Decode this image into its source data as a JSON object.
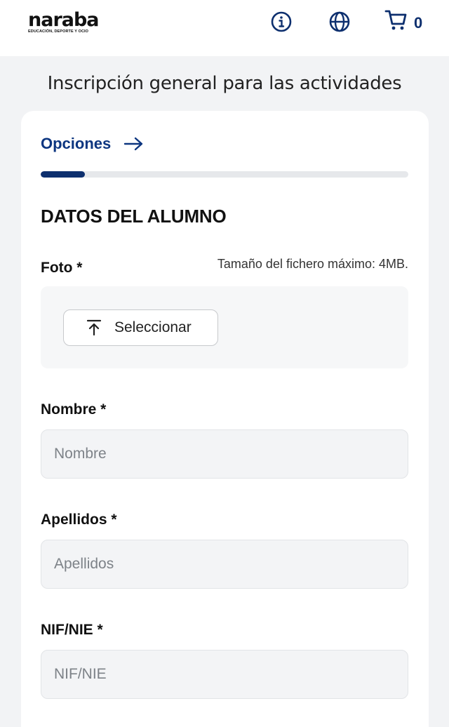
{
  "header": {
    "logo": {
      "word": "naraba",
      "tagline": "EDUCACIÓN, DEPORTE Y OCIO"
    },
    "icons": {
      "info": "info-icon",
      "language": "globe-icon",
      "cart": "cart-icon"
    },
    "cart_count": "0"
  },
  "page": {
    "title": "Inscripción general para las actividades"
  },
  "form": {
    "step_link": "Opciones",
    "progress_percent": 12,
    "section_title": "DATOS DEL ALUMNO",
    "photo": {
      "label": "Foto *",
      "size_note": "Tamaño del fichero máximo: 4MB.",
      "button_label": "Seleccionar"
    },
    "fields": [
      {
        "label": "Nombre *",
        "placeholder": "Nombre",
        "value": ""
      },
      {
        "label": "Apellidos *",
        "placeholder": "Apellidos",
        "value": ""
      },
      {
        "label": "NIF/NIE *",
        "placeholder": "NIF/NIE",
        "value": ""
      }
    ]
  },
  "colors": {
    "brand": "#0d2f6e",
    "link": "#0d3680",
    "background": "#f2f3f5"
  }
}
